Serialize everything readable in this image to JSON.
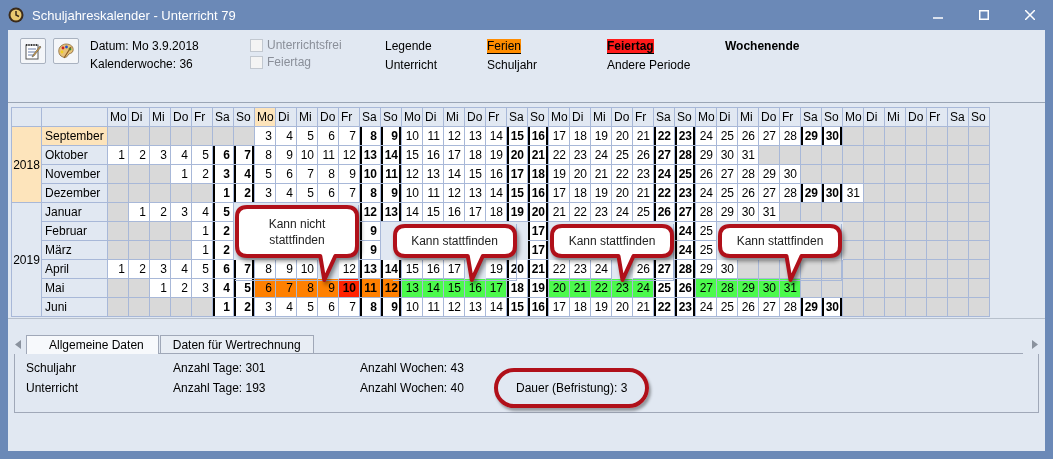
{
  "window": {
    "title": "Schuljahreskalender - Unterricht 79"
  },
  "info": {
    "date": "Datum: Mo 3.9.2018",
    "week": "Kalenderwoche: 36"
  },
  "checkboxes": [
    {
      "label": "Unterrichtsfrei",
      "checked": false,
      "disabled": true
    },
    {
      "label": "Feiertag",
      "checked": false,
      "disabled": true
    }
  ],
  "legend": [
    {
      "label": "Legende",
      "kind": "title"
    },
    {
      "label": "Ferien",
      "kind": "vacation"
    },
    {
      "label": "Feiertag",
      "kind": "holiday"
    },
    {
      "label": "Wochenende",
      "kind": "weekend"
    },
    {
      "label": "Unterricht",
      "kind": "plain"
    },
    {
      "label": "Schuljahr",
      "kind": "plain"
    },
    {
      "label": "Andere Periode",
      "kind": "plain"
    }
  ],
  "header_days": [
    {
      "label": "Mo",
      "selected": false
    },
    {
      "label": "Di",
      "selected": false
    },
    {
      "label": "Mi",
      "selected": false
    },
    {
      "label": "Do",
      "selected": false
    },
    {
      "label": "Fr",
      "selected": false
    },
    {
      "label": "Sa",
      "selected": false
    },
    {
      "label": "So",
      "selected": false
    },
    {
      "label": "Mo",
      "selected": true
    },
    {
      "label": "Di",
      "selected": false
    },
    {
      "label": "Mi",
      "selected": false
    },
    {
      "label": "Do",
      "selected": false
    },
    {
      "label": "Fr",
      "selected": false
    },
    {
      "label": "Sa",
      "selected": false
    },
    {
      "label": "So",
      "selected": false
    },
    {
      "label": "Mo",
      "selected": false
    },
    {
      "label": "Di",
      "selected": false
    },
    {
      "label": "Mi",
      "selected": false
    },
    {
      "label": "Do",
      "selected": false
    },
    {
      "label": "Fr",
      "selected": false
    },
    {
      "label": "Sa",
      "selected": false
    },
    {
      "label": "So",
      "selected": false
    },
    {
      "label": "Mo",
      "selected": false
    },
    {
      "label": "Di",
      "selected": false
    },
    {
      "label": "Mi",
      "selected": false
    },
    {
      "label": "Do",
      "selected": false
    },
    {
      "label": "Fr",
      "selected": false
    },
    {
      "label": "Sa",
      "selected": false
    },
    {
      "label": "So",
      "selected": false
    },
    {
      "label": "Mo",
      "selected": false
    },
    {
      "label": "Di",
      "selected": false
    },
    {
      "label": "Mi",
      "selected": false
    },
    {
      "label": "Do",
      "selected": false
    },
    {
      "label": "Fr",
      "selected": false
    },
    {
      "label": "Sa",
      "selected": false
    },
    {
      "label": "So",
      "selected": false
    },
    {
      "label": "Mo",
      "selected": false
    },
    {
      "label": "Di",
      "selected": false
    },
    {
      "label": "Mi",
      "selected": false
    },
    {
      "label": "Do",
      "selected": false
    },
    {
      "label": "Fr",
      "selected": false
    },
    {
      "label": "Sa",
      "selected": false
    },
    {
      "label": "So",
      "selected": false
    }
  ],
  "years": [
    {
      "year": "2018",
      "selected": true,
      "months": [
        {
          "name": "September",
          "selected": true,
          "cells": [
            {
              "kind": "blank"
            },
            {
              "kind": "blank"
            },
            {
              "kind": "blank"
            },
            {
              "kind": "blank"
            },
            {
              "kind": "blank"
            },
            {
              "kind": "blank"
            },
            {
              "kind": "blank"
            },
            {
              "kind": "day",
              "text": "3"
            },
            {
              "kind": "day",
              "text": "4"
            },
            {
              "kind": "day",
              "text": "5"
            },
            {
              "kind": "day",
              "text": "6"
            },
            {
              "kind": "day",
              "text": "7"
            },
            {
              "kind": "weekend",
              "text": "8"
            },
            {
              "kind": "weekend",
              "text": "9"
            },
            {
              "kind": "day",
              "text": "10"
            },
            {
              "kind": "day",
              "text": "11"
            },
            {
              "kind": "day",
              "text": "12"
            },
            {
              "kind": "day",
              "text": "13"
            },
            {
              "kind": "day",
              "text": "14"
            },
            {
              "kind": "weekend",
              "text": "15"
            },
            {
              "kind": "weekend",
              "text": "16"
            },
            {
              "kind": "day",
              "text": "17"
            },
            {
              "kind": "day",
              "text": "18"
            },
            {
              "kind": "day",
              "text": "19"
            },
            {
              "kind": "day",
              "text": "20"
            },
            {
              "kind": "day",
              "text": "21"
            },
            {
              "kind": "weekend",
              "text": "22"
            },
            {
              "kind": "weekend",
              "text": "23"
            },
            {
              "kind": "day",
              "text": "24"
            },
            {
              "kind": "day",
              "text": "25"
            },
            {
              "kind": "day",
              "text": "26"
            },
            {
              "kind": "day",
              "text": "27"
            },
            {
              "kind": "day",
              "text": "28"
            },
            {
              "kind": "weekend",
              "text": "29"
            },
            {
              "kind": "weekend",
              "text": "30"
            },
            {
              "kind": "blank"
            },
            {
              "kind": "blank"
            },
            {
              "kind": "blank"
            },
            {
              "kind": "blank"
            },
            {
              "kind": "blank"
            },
            {
              "kind": "blank"
            },
            {
              "kind": "blank"
            }
          ]
        },
        {
          "name": "Oktober",
          "selected": false,
          "cells": [
            {
              "kind": "day",
              "text": "1"
            },
            {
              "kind": "day",
              "text": "2"
            },
            {
              "kind": "day",
              "text": "3"
            },
            {
              "kind": "day",
              "text": "4"
            },
            {
              "kind": "day",
              "text": "5"
            },
            {
              "kind": "weekend",
              "text": "6"
            },
            {
              "kind": "weekend",
              "text": "7"
            },
            {
              "kind": "day",
              "text": "8"
            },
            {
              "kind": "day",
              "text": "9"
            },
            {
              "kind": "day",
              "text": "10"
            },
            {
              "kind": "day",
              "text": "11"
            },
            {
              "kind": "day",
              "text": "12"
            },
            {
              "kind": "weekend",
              "text": "13"
            },
            {
              "kind": "weekend",
              "text": "14"
            },
            {
              "kind": "day",
              "text": "15"
            },
            {
              "kind": "day",
              "text": "16"
            },
            {
              "kind": "day",
              "text": "17"
            },
            {
              "kind": "day",
              "text": "18"
            },
            {
              "kind": "day",
              "text": "19"
            },
            {
              "kind": "weekend",
              "text": "20"
            },
            {
              "kind": "weekend",
              "text": "21"
            },
            {
              "kind": "day",
              "text": "22"
            },
            {
              "kind": "day",
              "text": "23"
            },
            {
              "kind": "day",
              "text": "24"
            },
            {
              "kind": "day",
              "text": "25"
            },
            {
              "kind": "day",
              "text": "26"
            },
            {
              "kind": "weekend",
              "text": "27"
            },
            {
              "kind": "weekend",
              "text": "28"
            },
            {
              "kind": "day",
              "text": "29"
            },
            {
              "kind": "day",
              "text": "30"
            },
            {
              "kind": "day",
              "text": "31"
            },
            {
              "kind": "blank"
            },
            {
              "kind": "blank"
            },
            {
              "kind": "blank"
            },
            {
              "kind": "blank"
            },
            {
              "kind": "blank"
            },
            {
              "kind": "blank"
            },
            {
              "kind": "blank"
            },
            {
              "kind": "blank"
            },
            {
              "kind": "blank"
            },
            {
              "kind": "blank"
            },
            {
              "kind": "blank"
            }
          ]
        },
        {
          "name": "November",
          "selected": false,
          "cells": [
            {
              "kind": "blank"
            },
            {
              "kind": "blank"
            },
            {
              "kind": "blank"
            },
            {
              "kind": "day",
              "text": "1"
            },
            {
              "kind": "day",
              "text": "2"
            },
            {
              "kind": "weekend",
              "text": "3"
            },
            {
              "kind": "weekend",
              "text": "4"
            },
            {
              "kind": "day",
              "text": "5"
            },
            {
              "kind": "day",
              "text": "6"
            },
            {
              "kind": "day",
              "text": "7"
            },
            {
              "kind": "day",
              "text": "8"
            },
            {
              "kind": "day",
              "text": "9"
            },
            {
              "kind": "weekend",
              "text": "10"
            },
            {
              "kind": "weekend",
              "text": "11"
            },
            {
              "kind": "day",
              "text": "12"
            },
            {
              "kind": "day",
              "text": "13"
            },
            {
              "kind": "day",
              "text": "14"
            },
            {
              "kind": "day",
              "text": "15"
            },
            {
              "kind": "day",
              "text": "16"
            },
            {
              "kind": "weekend",
              "text": "17"
            },
            {
              "kind": "weekend",
              "text": "18"
            },
            {
              "kind": "day",
              "text": "19"
            },
            {
              "kind": "day",
              "text": "20"
            },
            {
              "kind": "day",
              "text": "21"
            },
            {
              "kind": "day",
              "text": "22"
            },
            {
              "kind": "day",
              "text": "23"
            },
            {
              "kind": "weekend",
              "text": "24"
            },
            {
              "kind": "weekend",
              "text": "25"
            },
            {
              "kind": "day",
              "text": "26"
            },
            {
              "kind": "day",
              "text": "27"
            },
            {
              "kind": "day",
              "text": "28"
            },
            {
              "kind": "day",
              "text": "29"
            },
            {
              "kind": "day",
              "text": "30"
            },
            {
              "kind": "blank"
            },
            {
              "kind": "blank"
            },
            {
              "kind": "blank"
            },
            {
              "kind": "blank"
            },
            {
              "kind": "blank"
            },
            {
              "kind": "blank"
            },
            {
              "kind": "blank"
            },
            {
              "kind": "blank"
            },
            {
              "kind": "blank"
            }
          ]
        },
        {
          "name": "Dezember",
          "selected": false,
          "cells": [
            {
              "kind": "blank"
            },
            {
              "kind": "blank"
            },
            {
              "kind": "blank"
            },
            {
              "kind": "blank"
            },
            {
              "kind": "blank"
            },
            {
              "kind": "weekend",
              "text": "1"
            },
            {
              "kind": "weekend",
              "text": "2"
            },
            {
              "kind": "day",
              "text": "3"
            },
            {
              "kind": "day",
              "text": "4"
            },
            {
              "kind": "day",
              "text": "5"
            },
            {
              "kind": "day",
              "text": "6"
            },
            {
              "kind": "day",
              "text": "7"
            },
            {
              "kind": "weekend",
              "text": "8"
            },
            {
              "kind": "weekend",
              "text": "9"
            },
            {
              "kind": "day",
              "text": "10"
            },
            {
              "kind": "day",
              "text": "11"
            },
            {
              "kind": "day",
              "text": "12"
            },
            {
              "kind": "day",
              "text": "13"
            },
            {
              "kind": "day",
              "text": "14"
            },
            {
              "kind": "weekend",
              "text": "15"
            },
            {
              "kind": "weekend",
              "text": "16"
            },
            {
              "kind": "day",
              "text": "17"
            },
            {
              "kind": "day",
              "text": "18"
            },
            {
              "kind": "day",
              "text": "19"
            },
            {
              "kind": "day",
              "text": "20"
            },
            {
              "kind": "day",
              "text": "21"
            },
            {
              "kind": "weekend",
              "text": "22"
            },
            {
              "kind": "weekend",
              "text": "23"
            },
            {
              "kind": "day",
              "text": "24"
            },
            {
              "kind": "day",
              "text": "25"
            },
            {
              "kind": "day",
              "text": "26"
            },
            {
              "kind": "day",
              "text": "27"
            },
            {
              "kind": "day",
              "text": "28"
            },
            {
              "kind": "weekend",
              "text": "29"
            },
            {
              "kind": "weekend",
              "text": "30"
            },
            {
              "kind": "day",
              "text": "31"
            },
            {
              "kind": "blank"
            },
            {
              "kind": "blank"
            },
            {
              "kind": "blank"
            },
            {
              "kind": "blank"
            },
            {
              "kind": "blank"
            },
            {
              "kind": "blank"
            }
          ]
        }
      ]
    },
    {
      "year": "2019",
      "selected": false,
      "months": [
        {
          "name": "Januar",
          "selected": false,
          "cells": [
            {
              "kind": "blank"
            },
            {
              "kind": "day",
              "text": "1"
            },
            {
              "kind": "day",
              "text": "2"
            },
            {
              "kind": "day",
              "text": "3"
            },
            {
              "kind": "day",
              "text": "4"
            },
            {
              "kind": "weekend",
              "text": "5"
            },
            {
              "kind": "covered"
            },
            {
              "kind": "covered"
            },
            {
              "kind": "covered"
            },
            {
              "kind": "covered"
            },
            {
              "kind": "covered"
            },
            {
              "kind": "covered"
            },
            {
              "kind": "weekend",
              "text": "12"
            },
            {
              "kind": "weekend",
              "text": "13"
            },
            {
              "kind": "day",
              "text": "14"
            },
            {
              "kind": "day",
              "text": "15"
            },
            {
              "kind": "day",
              "text": "16"
            },
            {
              "kind": "day",
              "text": "17"
            },
            {
              "kind": "day",
              "text": "18"
            },
            {
              "kind": "weekend",
              "text": "19"
            },
            {
              "kind": "weekend",
              "text": "20"
            },
            {
              "kind": "day",
              "text": "21"
            },
            {
              "kind": "day",
              "text": "22"
            },
            {
              "kind": "day",
              "text": "23"
            },
            {
              "kind": "day",
              "text": "24"
            },
            {
              "kind": "day",
              "text": "25"
            },
            {
              "kind": "weekend",
              "text": "26"
            },
            {
              "kind": "weekend",
              "text": "27"
            },
            {
              "kind": "day",
              "text": "28"
            },
            {
              "kind": "day",
              "text": "29"
            },
            {
              "kind": "day",
              "text": "30"
            },
            {
              "kind": "day",
              "text": "31"
            },
            {
              "kind": "blank"
            },
            {
              "kind": "blank"
            },
            {
              "kind": "blank"
            },
            {
              "kind": "blank"
            },
            {
              "kind": "blank"
            },
            {
              "kind": "blank"
            },
            {
              "kind": "blank"
            },
            {
              "kind": "blank"
            },
            {
              "kind": "blank"
            },
            {
              "kind": "blank"
            }
          ]
        },
        {
          "name": "Februar",
          "selected": false,
          "cells": [
            {
              "kind": "blank"
            },
            {
              "kind": "blank"
            },
            {
              "kind": "blank"
            },
            {
              "kind": "blank"
            },
            {
              "kind": "day",
              "text": "1"
            },
            {
              "kind": "weekend",
              "text": "2"
            },
            {
              "kind": "covered"
            },
            {
              "kind": "covered"
            },
            {
              "kind": "covered"
            },
            {
              "kind": "covered"
            },
            {
              "kind": "covered"
            },
            {
              "kind": "covered"
            },
            {
              "kind": "weekend",
              "text": "9"
            },
            {
              "kind": "covered"
            },
            {
              "kind": "covered"
            },
            {
              "kind": "covered"
            },
            {
              "kind": "covered"
            },
            {
              "kind": "covered"
            },
            {
              "kind": "covered"
            },
            {
              "kind": "covered"
            },
            {
              "kind": "weekend",
              "text": "17"
            },
            {
              "kind": "covered"
            },
            {
              "kind": "covered"
            },
            {
              "kind": "covered"
            },
            {
              "kind": "covered"
            },
            {
              "kind": "covered"
            },
            {
              "kind": "covered"
            },
            {
              "kind": "weekend",
              "text": "24"
            },
            {
              "kind": "day",
              "text": "25"
            },
            {
              "kind": "covered"
            },
            {
              "kind": "covered"
            },
            {
              "kind": "covered"
            },
            {
              "kind": "covered"
            },
            {
              "kind": "covered"
            },
            {
              "kind": "covered"
            },
            {
              "kind": "blank"
            },
            {
              "kind": "blank"
            },
            {
              "kind": "blank"
            },
            {
              "kind": "blank"
            },
            {
              "kind": "blank"
            },
            {
              "kind": "blank"
            },
            {
              "kind": "blank"
            }
          ]
        },
        {
          "name": "März",
          "selected": false,
          "cells": [
            {
              "kind": "blank"
            },
            {
              "kind": "blank"
            },
            {
              "kind": "blank"
            },
            {
              "kind": "blank"
            },
            {
              "kind": "day",
              "text": "1"
            },
            {
              "kind": "weekend",
              "text": "2"
            },
            {
              "kind": "covered"
            },
            {
              "kind": "covered"
            },
            {
              "kind": "covered"
            },
            {
              "kind": "covered"
            },
            {
              "kind": "covered"
            },
            {
              "kind": "covered"
            },
            {
              "kind": "weekend",
              "text": "9"
            },
            {
              "kind": "covered"
            },
            {
              "kind": "covered"
            },
            {
              "kind": "covered"
            },
            {
              "kind": "covered"
            },
            {
              "kind": "covered"
            },
            {
              "kind": "covered"
            },
            {
              "kind": "covered"
            },
            {
              "kind": "weekend",
              "text": "17"
            },
            {
              "kind": "covered"
            },
            {
              "kind": "covered"
            },
            {
              "kind": "covered"
            },
            {
              "kind": "covered"
            },
            {
              "kind": "covered"
            },
            {
              "kind": "covered"
            },
            {
              "kind": "weekend",
              "text": "24"
            },
            {
              "kind": "day",
              "text": "25"
            },
            {
              "kind": "covered"
            },
            {
              "kind": "covered"
            },
            {
              "kind": "covered"
            },
            {
              "kind": "covered"
            },
            {
              "kind": "covered"
            },
            {
              "kind": "covered"
            },
            {
              "kind": "blank"
            },
            {
              "kind": "blank"
            },
            {
              "kind": "blank"
            },
            {
              "kind": "blank"
            },
            {
              "kind": "blank"
            },
            {
              "kind": "blank"
            },
            {
              "kind": "blank"
            }
          ]
        },
        {
          "name": "April",
          "selected": false,
          "cells": [
            {
              "kind": "day",
              "text": "1"
            },
            {
              "kind": "day",
              "text": "2"
            },
            {
              "kind": "day",
              "text": "3"
            },
            {
              "kind": "day",
              "text": "4"
            },
            {
              "kind": "day",
              "text": "5"
            },
            {
              "kind": "weekend",
              "text": "6"
            },
            {
              "kind": "weekend",
              "text": "7"
            },
            {
              "kind": "day",
              "text": "8"
            },
            {
              "kind": "day",
              "text": "9"
            },
            {
              "kind": "day",
              "text": "10"
            },
            {
              "kind": "covered"
            },
            {
              "kind": "day",
              "text": "12"
            },
            {
              "kind": "weekend",
              "text": "13"
            },
            {
              "kind": "weekend",
              "text": "14"
            },
            {
              "kind": "day",
              "text": "15"
            },
            {
              "kind": "day",
              "text": "16"
            },
            {
              "kind": "day",
              "text": "17"
            },
            {
              "kind": "covered"
            },
            {
              "kind": "day",
              "text": "19"
            },
            {
              "kind": "weekend",
              "text": "20"
            },
            {
              "kind": "weekend",
              "text": "21"
            },
            {
              "kind": "day",
              "text": "22"
            },
            {
              "kind": "day",
              "text": "23"
            },
            {
              "kind": "day",
              "text": "24"
            },
            {
              "kind": "covered"
            },
            {
              "kind": "day",
              "text": "26"
            },
            {
              "kind": "weekend",
              "text": "27"
            },
            {
              "kind": "weekend",
              "text": "28"
            },
            {
              "kind": "day",
              "text": "29"
            },
            {
              "kind": "day",
              "text": "30"
            },
            {
              "kind": "blank"
            },
            {
              "kind": "blank"
            },
            {
              "kind": "blank"
            },
            {
              "kind": "blank"
            },
            {
              "kind": "blank"
            },
            {
              "kind": "blank"
            },
            {
              "kind": "blank"
            },
            {
              "kind": "blank"
            },
            {
              "kind": "blank"
            },
            {
              "kind": "blank"
            },
            {
              "kind": "blank"
            },
            {
              "kind": "blank"
            }
          ]
        },
        {
          "name": "Mai",
          "selected": false,
          "cells": [
            {
              "kind": "blank"
            },
            {
              "kind": "blank"
            },
            {
              "kind": "day",
              "text": "1"
            },
            {
              "kind": "day",
              "text": "2"
            },
            {
              "kind": "day",
              "text": "3"
            },
            {
              "kind": "weekend",
              "text": "4"
            },
            {
              "kind": "weekend",
              "text": "5"
            },
            {
              "kind": "vacation",
              "text": "6"
            },
            {
              "kind": "vacation",
              "text": "7"
            },
            {
              "kind": "vacation",
              "text": "8"
            },
            {
              "kind": "vacation",
              "text": "9"
            },
            {
              "kind": "holiday",
              "text": "10"
            },
            {
              "kind": "vacation_weekend",
              "text": "11"
            },
            {
              "kind": "vacation_weekend",
              "text": "12"
            },
            {
              "kind": "period",
              "text": "13"
            },
            {
              "kind": "period",
              "text": "14"
            },
            {
              "kind": "period",
              "text": "15"
            },
            {
              "kind": "period",
              "text": "16"
            },
            {
              "kind": "period",
              "text": "17"
            },
            {
              "kind": "weekend",
              "text": "18"
            },
            {
              "kind": "weekend",
              "text": "19"
            },
            {
              "kind": "period",
              "text": "20"
            },
            {
              "kind": "period",
              "text": "21"
            },
            {
              "kind": "period",
              "text": "22"
            },
            {
              "kind": "period",
              "text": "23"
            },
            {
              "kind": "period",
              "text": "24"
            },
            {
              "kind": "weekend",
              "text": "25"
            },
            {
              "kind": "weekend",
              "text": "26"
            },
            {
              "kind": "period",
              "text": "27"
            },
            {
              "kind": "period",
              "text": "28"
            },
            {
              "kind": "period",
              "text": "29"
            },
            {
              "kind": "period",
              "text": "30"
            },
            {
              "kind": "period",
              "text": "31"
            },
            {
              "kind": "blank"
            },
            {
              "kind": "blank"
            },
            {
              "kind": "blank"
            },
            {
              "kind": "blank"
            },
            {
              "kind": "blank"
            },
            {
              "kind": "blank"
            },
            {
              "kind": "blank"
            },
            {
              "kind": "blank"
            },
            {
              "kind": "blank"
            }
          ]
        },
        {
          "name": "Juni",
          "selected": false,
          "cells": [
            {
              "kind": "blank"
            },
            {
              "kind": "blank"
            },
            {
              "kind": "blank"
            },
            {
              "kind": "blank"
            },
            {
              "kind": "blank"
            },
            {
              "kind": "weekend",
              "text": "1"
            },
            {
              "kind": "weekend",
              "text": "2"
            },
            {
              "kind": "day",
              "text": "3"
            },
            {
              "kind": "day",
              "text": "4"
            },
            {
              "kind": "day",
              "text": "5"
            },
            {
              "kind": "day",
              "text": "6"
            },
            {
              "kind": "day",
              "text": "7"
            },
            {
              "kind": "weekend",
              "text": "8"
            },
            {
              "kind": "weekend",
              "text": "9"
            },
            {
              "kind": "day",
              "text": "10"
            },
            {
              "kind": "day",
              "text": "11"
            },
            {
              "kind": "day",
              "text": "12"
            },
            {
              "kind": "day",
              "text": "13"
            },
            {
              "kind": "day",
              "text": "14"
            },
            {
              "kind": "weekend",
              "text": "15"
            },
            {
              "kind": "weekend",
              "text": "16"
            },
            {
              "kind": "day",
              "text": "17"
            },
            {
              "kind": "day",
              "text": "18"
            },
            {
              "kind": "day",
              "text": "19"
            },
            {
              "kind": "day",
              "text": "20"
            },
            {
              "kind": "day",
              "text": "21"
            },
            {
              "kind": "weekend",
              "text": "22"
            },
            {
              "kind": "weekend",
              "text": "23"
            },
            {
              "kind": "day",
              "text": "24"
            },
            {
              "kind": "day",
              "text": "25"
            },
            {
              "kind": "day",
              "text": "26"
            },
            {
              "kind": "day",
              "text": "27"
            },
            {
              "kind": "day",
              "text": "28"
            },
            {
              "kind": "weekend",
              "text": "29"
            },
            {
              "kind": "weekend",
              "text": "30"
            },
            {
              "kind": "blank"
            },
            {
              "kind": "blank"
            },
            {
              "kind": "blank"
            },
            {
              "kind": "blank"
            },
            {
              "kind": "blank"
            },
            {
              "kind": "blank"
            },
            {
              "kind": "blank"
            }
          ]
        }
      ]
    }
  ],
  "callouts": [
    {
      "text": "Kann nicht stattfinden"
    },
    {
      "text": "Kann stattfinden"
    },
    {
      "text": "Kann stattfinden"
    },
    {
      "text": "Kann stattfinden"
    }
  ],
  "tabs": [
    {
      "label": "Allgemeine Daten",
      "selected": true
    },
    {
      "label": "Daten für Wertrechnung",
      "selected": false
    }
  ],
  "stats": [
    {
      "label": "Schuljahr",
      "days": "Anzahl Tage: 301",
      "weeks": "Anzahl Wochen: 43"
    },
    {
      "label": "Unterricht",
      "days": "Anzahl Tage: 193",
      "weeks": "Anzahl Wochen: 40",
      "extra": "Dauer (Befristung): 3",
      "highlighted": true
    }
  ]
}
